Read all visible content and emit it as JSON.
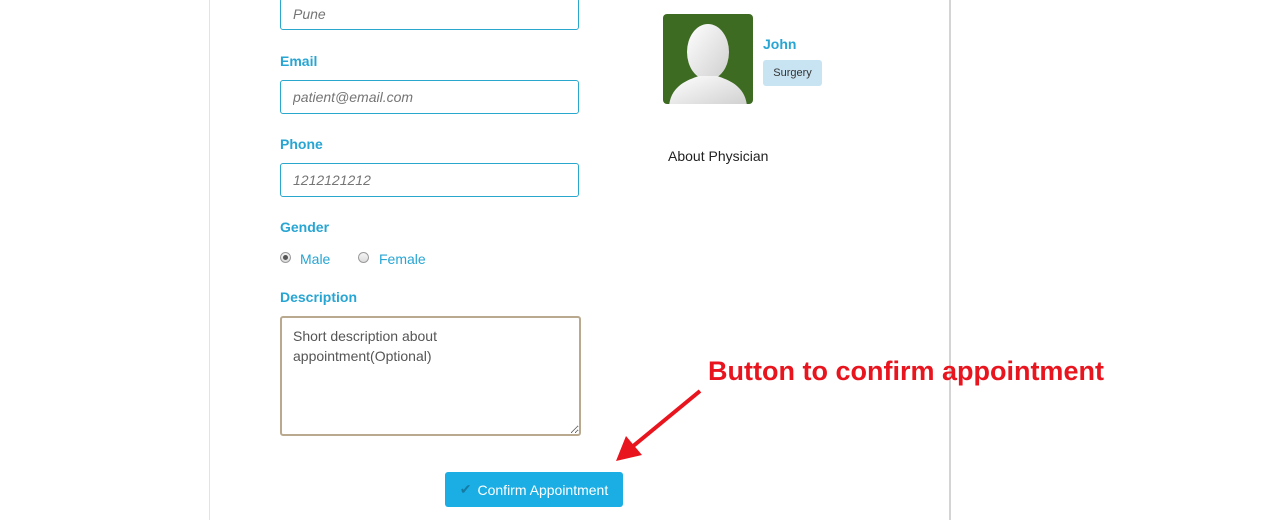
{
  "form": {
    "city": {
      "value": "",
      "placeholder": "Pune"
    },
    "email": {
      "label": "Email",
      "value": "",
      "placeholder": "patient@email.com"
    },
    "phone": {
      "label": "Phone",
      "value": "",
      "placeholder": "1212121212"
    },
    "gender": {
      "label": "Gender",
      "options": [
        {
          "label": "Male",
          "checked": true
        },
        {
          "label": "Female",
          "checked": false
        }
      ]
    },
    "description": {
      "label": "Description",
      "value": "Short description about appointment(Optional)"
    },
    "confirm_button": {
      "label": "Confirm Appointment",
      "icon": "check-icon"
    }
  },
  "physician": {
    "name": "John",
    "specialty": "Surgery",
    "about_label": "About Physician",
    "avatar_icon": "user-silhouette-icon"
  },
  "annotation": {
    "text": "Button to confirm appointment",
    "color": "#e8141e"
  },
  "colors": {
    "accent": "#27a5d3",
    "button": "#1aaee4",
    "avatar_bg": "#3e6b22",
    "badge_bg": "#c8e3f1"
  }
}
